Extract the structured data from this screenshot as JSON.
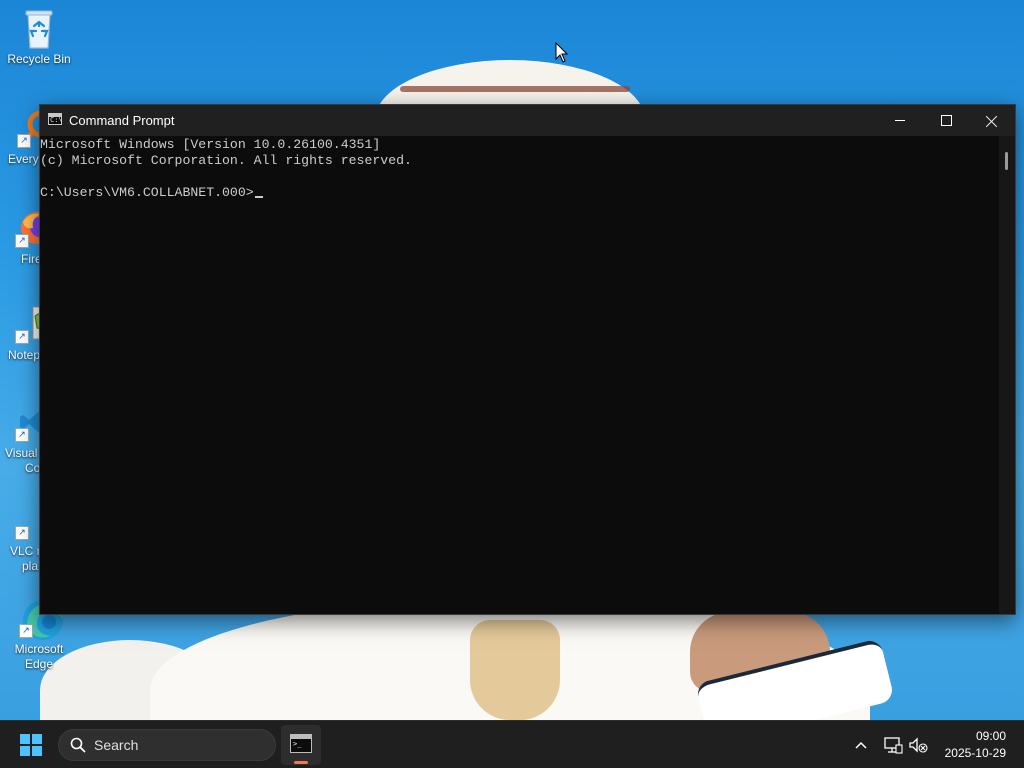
{
  "desktop": {
    "icons": [
      {
        "label": "Recycle Bin"
      },
      {
        "label": "Every"
      },
      {
        "label": "Fire"
      },
      {
        "label": "Notep"
      },
      {
        "label": "Visual",
        "label2": "Co"
      },
      {
        "label": "VLC m",
        "label2": "pla"
      },
      {
        "label": "Microsoft",
        "label2": "Edge"
      }
    ]
  },
  "window": {
    "title": "Command Prompt",
    "icon": "cmd-icon",
    "controls": [
      "minimize-icon",
      "maximize-icon",
      "close-icon"
    ],
    "console_lines": [
      "Microsoft Windows [Version 10.0.26100.4351]",
      "(c) Microsoft Corporation. All rights reserved.",
      "",
      "C:\\Users\\VM6.COLLABNET.000>"
    ],
    "background_color": "#0c0c0c",
    "text_color": "#cccccc"
  },
  "taskbar": {
    "search_placeholder": "Search",
    "pinned": [
      "command-prompt"
    ],
    "tray_icons": [
      "chevron-up-icon",
      "network-icon",
      "volume-muted-icon"
    ],
    "time": "09:00",
    "date": "2025-10-29",
    "accent_color": "#4cc2ff"
  }
}
